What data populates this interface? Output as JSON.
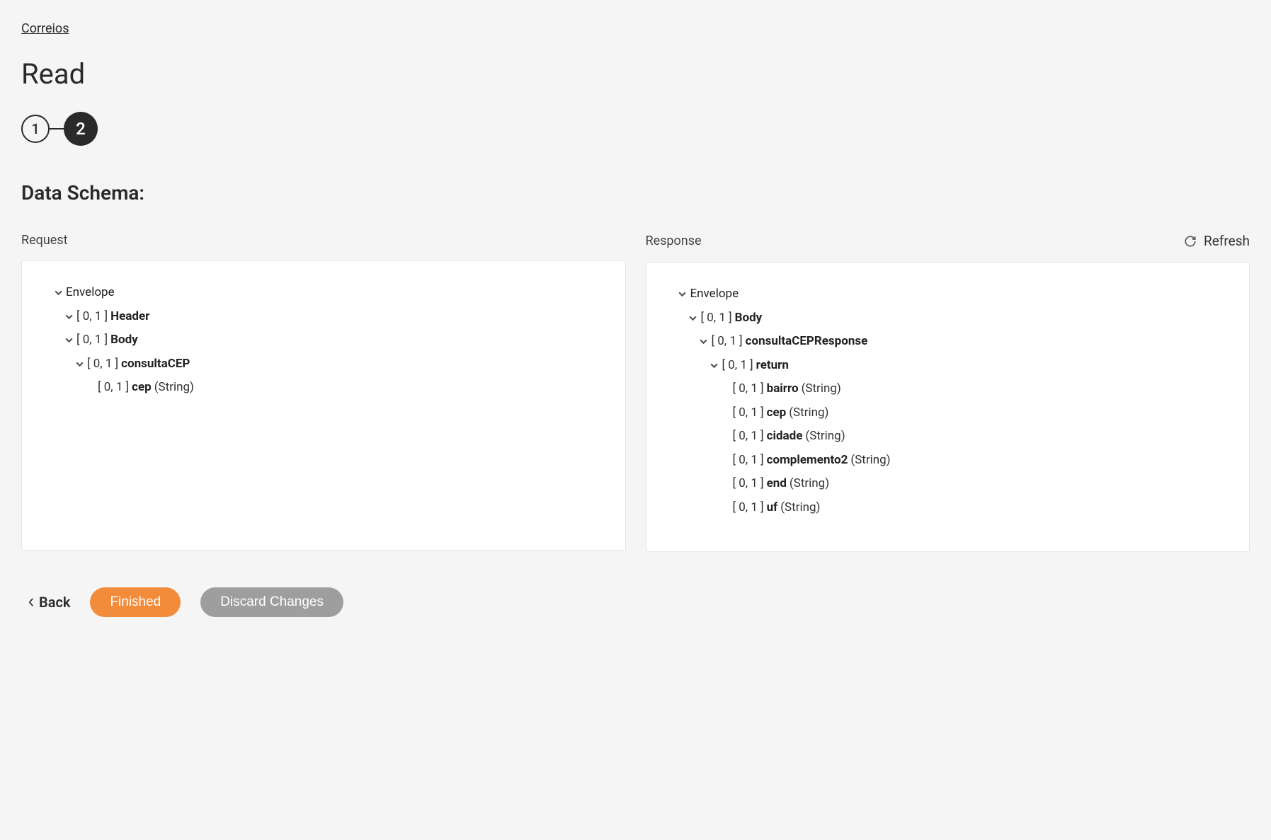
{
  "breadcrumb": {
    "label": "Correios"
  },
  "page_title": "Read",
  "stepper": {
    "step1": "1",
    "step2": "2"
  },
  "section_title": "Data Schema:",
  "columns": {
    "request_label": "Request",
    "response_label": "Response",
    "refresh_label": "Refresh"
  },
  "request_tree": {
    "envelope": "Envelope",
    "header_card": "[ 0, 1 ]",
    "header_name": "Header",
    "body_card": "[ 0, 1 ]",
    "body_name": "Body",
    "consultaCEP_card": "[ 0, 1 ]",
    "consultaCEP_name": "consultaCEP",
    "cep_card": "[ 0, 1 ]",
    "cep_name": "cep",
    "cep_type": "(String)"
  },
  "response_tree": {
    "envelope": "Envelope",
    "body_card": "[ 0, 1 ]",
    "body_name": "Body",
    "consultaCEPResponse_card": "[ 0, 1 ]",
    "consultaCEPResponse_name": "consultaCEPResponse",
    "return_card": "[ 0, 1 ]",
    "return_name": "return",
    "fields": [
      {
        "card": "[ 0, 1 ]",
        "name": "bairro",
        "type": "(String)"
      },
      {
        "card": "[ 0, 1 ]",
        "name": "cep",
        "type": "(String)"
      },
      {
        "card": "[ 0, 1 ]",
        "name": "cidade",
        "type": "(String)"
      },
      {
        "card": "[ 0, 1 ]",
        "name": "complemento2",
        "type": "(String)"
      },
      {
        "card": "[ 0, 1 ]",
        "name": "end",
        "type": "(String)"
      },
      {
        "card": "[ 0, 1 ]",
        "name": "uf",
        "type": "(String)"
      }
    ]
  },
  "actions": {
    "back": "Back",
    "finished": "Finished",
    "discard": "Discard Changes"
  }
}
